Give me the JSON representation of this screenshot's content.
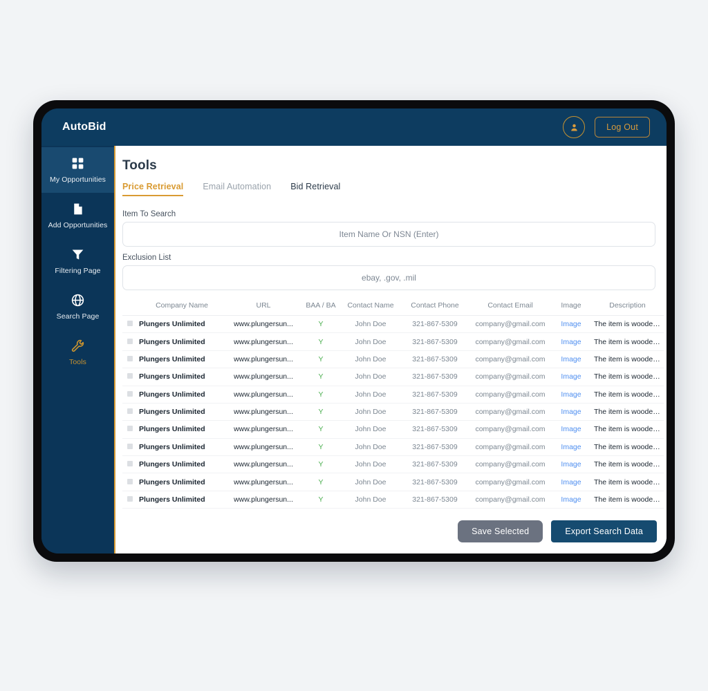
{
  "topbar": {
    "brand": "AutoBid",
    "avatar_icon": "user-icon",
    "logout_label": "Log Out"
  },
  "sidebar": {
    "items": [
      {
        "label": "My Opportunities",
        "icon": "grid-icon",
        "state": "highlight"
      },
      {
        "label": "Add Opportunities",
        "icon": "file-icon",
        "state": "normal"
      },
      {
        "label": "Filtering Page",
        "icon": "funnel-icon",
        "state": "normal"
      },
      {
        "label": "Search Page",
        "icon": "globe-icon",
        "state": "normal"
      },
      {
        "label": "Tools",
        "icon": "wrench-icon",
        "state": "active"
      }
    ]
  },
  "main": {
    "title": "Tools",
    "tabs": [
      {
        "label": "Price Retrieval",
        "state": "active"
      },
      {
        "label": "Email Automation",
        "state": "muted"
      },
      {
        "label": "Bid Retrieval",
        "state": "normal"
      }
    ],
    "fields": [
      {
        "label": "Item To Search",
        "value": "",
        "placeholder": "Item Name Or NSN (Enter)"
      },
      {
        "label": "Exclusion List",
        "value": "",
        "placeholder": "ebay, .gov, .mil"
      }
    ],
    "table": {
      "columns": [
        "Company Name",
        "URL",
        "BAA / BA",
        "Contact Name",
        "Contact Phone",
        "Contact Email",
        "Image",
        "Description"
      ],
      "rows": [
        {
          "company": "Plungers Unlimited",
          "url": "www.plungersun...",
          "baa": "Y",
          "contact_name": "John Doe",
          "contact_phone": "321-867-5309",
          "contact_email": "company@gmail.com",
          "image": "Image",
          "description": "The item is wooden and mea..."
        },
        {
          "company": "Plungers Unlimited",
          "url": "www.plungersun...",
          "baa": "Y",
          "contact_name": "John Doe",
          "contact_phone": "321-867-5309",
          "contact_email": "company@gmail.com",
          "image": "Image",
          "description": "The item is wooden and mea..."
        },
        {
          "company": "Plungers Unlimited",
          "url": "www.plungersun...",
          "baa": "Y",
          "contact_name": "John Doe",
          "contact_phone": "321-867-5309",
          "contact_email": "company@gmail.com",
          "image": "Image",
          "description": "The item is wooden and mea..."
        },
        {
          "company": "Plungers Unlimited",
          "url": "www.plungersun...",
          "baa": "Y",
          "contact_name": "John Doe",
          "contact_phone": "321-867-5309",
          "contact_email": "company@gmail.com",
          "image": "Image",
          "description": "The item is wooden and mea..."
        },
        {
          "company": "Plungers Unlimited",
          "url": "www.plungersun...",
          "baa": "Y",
          "contact_name": "John Doe",
          "contact_phone": "321-867-5309",
          "contact_email": "company@gmail.com",
          "image": "Image",
          "description": "The item is wooden and mea..."
        },
        {
          "company": "Plungers Unlimited",
          "url": "www.plungersun...",
          "baa": "Y",
          "contact_name": "John Doe",
          "contact_phone": "321-867-5309",
          "contact_email": "company@gmail.com",
          "image": "Image",
          "description": "The item is wooden and mea..."
        },
        {
          "company": "Plungers Unlimited",
          "url": "www.plungersun...",
          "baa": "Y",
          "contact_name": "John Doe",
          "contact_phone": "321-867-5309",
          "contact_email": "company@gmail.com",
          "image": "Image",
          "description": "The item is wooden and mea..."
        },
        {
          "company": "Plungers Unlimited",
          "url": "www.plungersun...",
          "baa": "Y",
          "contact_name": "John Doe",
          "contact_phone": "321-867-5309",
          "contact_email": "company@gmail.com",
          "image": "Image",
          "description": "The item is wooden and mea..."
        },
        {
          "company": "Plungers Unlimited",
          "url": "www.plungersun...",
          "baa": "Y",
          "contact_name": "John Doe",
          "contact_phone": "321-867-5309",
          "contact_email": "company@gmail.com",
          "image": "Image",
          "description": "The item is wooden and mea..."
        },
        {
          "company": "Plungers Unlimited",
          "url": "www.plungersun...",
          "baa": "Y",
          "contact_name": "John Doe",
          "contact_phone": "321-867-5309",
          "contact_email": "company@gmail.com",
          "image": "Image",
          "description": "The item is wooden and mea..."
        },
        {
          "company": "Plungers Unlimited",
          "url": "www.plungersun...",
          "baa": "Y",
          "contact_name": "John Doe",
          "contact_phone": "321-867-5309",
          "contact_email": "company@gmail.com",
          "image": "Image",
          "description": "The item is wooden and mea..."
        }
      ]
    },
    "footer": {
      "save_label": "Save Selected",
      "export_label": "Export Search Data"
    }
  },
  "colors": {
    "page_background": "#f2f4f6",
    "bezel": "#0b0b0d",
    "navy_topbar": "#0d3c60",
    "navy_sidebar": "#0b3558",
    "navy_highlight": "#194a70",
    "gold": "#d99b33",
    "gold_dim": "#c8922f",
    "link_blue": "#4f8ff0",
    "green": "#4caf50",
    "gray_button": "#6b7280",
    "navy_button": "#164b70"
  }
}
